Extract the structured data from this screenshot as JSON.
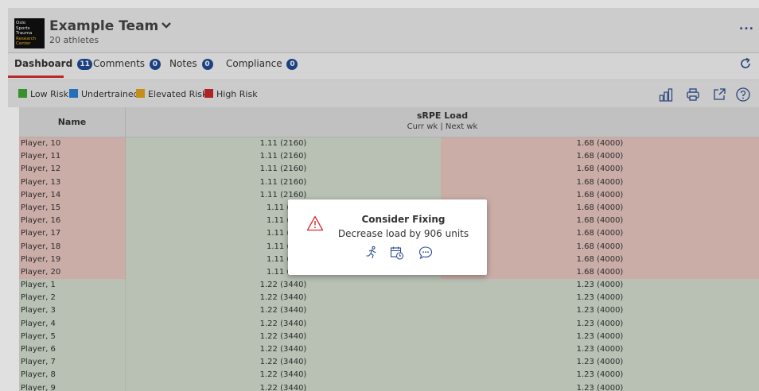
{
  "header": {
    "logo_lines": [
      "Oslo",
      "Sports",
      "Trauma",
      "Research",
      "Center"
    ],
    "team_name": "Example Team",
    "athlete_count": "20 athletes",
    "more_label": "..."
  },
  "tabs": [
    {
      "label": "Dashboard",
      "badge": "11",
      "active": true
    },
    {
      "label": "Comments",
      "badge": "0"
    },
    {
      "label": "Notes",
      "badge": "0"
    },
    {
      "label": "Compliance",
      "badge": "0"
    }
  ],
  "legend": [
    {
      "label": "Low Risk",
      "color": "#3fa535"
    },
    {
      "label": "Undertrained",
      "color": "#2c7fd2"
    },
    {
      "label": "Elevated Risk",
      "color": "#e0a21d"
    },
    {
      "label": "High Risk",
      "color": "#c62828"
    }
  ],
  "toolbar_icons": [
    "bar-chart-icon",
    "print-icon",
    "export-icon",
    "help-icon"
  ],
  "table": {
    "name_header": "Name",
    "load_header": "sRPE Load",
    "load_subheader": "Curr wk | Next wk",
    "rows": [
      {
        "name": "Player, 10",
        "curr": "1.11 (2160)",
        "next": "1.68 (4000)",
        "risk": "high"
      },
      {
        "name": "Player, 11",
        "curr": "1.11 (2160)",
        "next": "1.68 (4000)",
        "risk": "high"
      },
      {
        "name": "Player, 12",
        "curr": "1.11 (2160)",
        "next": "1.68 (4000)",
        "risk": "high"
      },
      {
        "name": "Player, 13",
        "curr": "1.11 (2160)",
        "next": "1.68 (4000)",
        "risk": "high"
      },
      {
        "name": "Player, 14",
        "curr": "1.11 (2160)",
        "next": "1.68 (4000)",
        "risk": "high"
      },
      {
        "name": "Player, 15",
        "curr": "1.11 (21",
        "next": "1.68 (4000)",
        "risk": "high"
      },
      {
        "name": "Player, 16",
        "curr": "1.11 (21",
        "next": "1.68 (4000)",
        "risk": "high"
      },
      {
        "name": "Player, 17",
        "curr": "1.11 (21",
        "next": "1.68 (4000)",
        "risk": "high"
      },
      {
        "name": "Player, 18",
        "curr": "1.11 (21",
        "next": "1.68 (4000)",
        "risk": "high"
      },
      {
        "name": "Player, 19",
        "curr": "1.11 (21",
        "next": "1.68 (4000)",
        "risk": "high"
      },
      {
        "name": "Player, 20",
        "curr": "1.11 (21",
        "next": "1.68 (4000)",
        "risk": "high"
      },
      {
        "name": "Player, 1",
        "curr": "1.22 (3440)",
        "next": "1.23 (4000)",
        "risk": "low"
      },
      {
        "name": "Player, 2",
        "curr": "1.22 (3440)",
        "next": "1.23 (4000)",
        "risk": "low"
      },
      {
        "name": "Player, 3",
        "curr": "1.22 (3440)",
        "next": "1.23 (4000)",
        "risk": "low"
      },
      {
        "name": "Player, 4",
        "curr": "1.22 (3440)",
        "next": "1.23 (4000)",
        "risk": "low"
      },
      {
        "name": "Player, 5",
        "curr": "1.22 (3440)",
        "next": "1.23 (4000)",
        "risk": "low"
      },
      {
        "name": "Player, 6",
        "curr": "1.22 (3440)",
        "next": "1.23 (4000)",
        "risk": "low"
      },
      {
        "name": "Player, 7",
        "curr": "1.22 (3440)",
        "next": "1.23 (4000)",
        "risk": "low"
      },
      {
        "name": "Player, 8",
        "curr": "1.22 (3440)",
        "next": "1.23 (4000)",
        "risk": "low"
      },
      {
        "name": "Player, 9",
        "curr": "1.22 (3440)",
        "next": "1.23 (4000)",
        "risk": "low"
      }
    ]
  },
  "popup": {
    "title": "Consider Fixing",
    "message": "Decrease load by 906 units",
    "icons": [
      "running-icon",
      "calendar-clock-icon",
      "comment-icon"
    ]
  }
}
